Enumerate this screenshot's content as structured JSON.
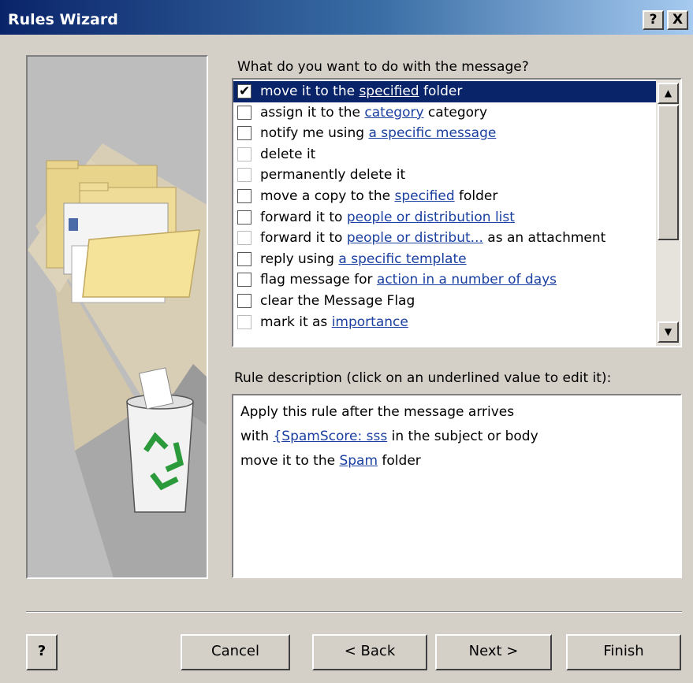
{
  "window": {
    "title": "Rules Wizard",
    "help_glyph": "?",
    "close_glyph": "X"
  },
  "actions": {
    "prompt": "What do you want to do with the message?",
    "items": [
      {
        "pre": "move it to the ",
        "link": "specified",
        "post": " folder",
        "checked": true,
        "selected": true
      },
      {
        "pre": "assign it to the ",
        "link": "category",
        "post": " category",
        "checked": false,
        "selected": false
      },
      {
        "pre": "notify me using ",
        "link": "a specific message",
        "post": "",
        "checked": false,
        "selected": false
      },
      {
        "pre": "delete it",
        "link": "",
        "post": "",
        "checked": false,
        "selected": false
      },
      {
        "pre": "permanently delete it",
        "link": "",
        "post": "",
        "checked": false,
        "selected": false
      },
      {
        "pre": "move a copy to the ",
        "link": "specified",
        "post": " folder",
        "checked": false,
        "selected": false
      },
      {
        "pre": "forward it to ",
        "link": "people or distribution list",
        "post": "",
        "checked": false,
        "selected": false
      },
      {
        "pre": "forward it to ",
        "link": "people or distribut...",
        "post": "  as an attachment",
        "checked": false,
        "selected": false
      },
      {
        "pre": "reply using ",
        "link": "a specific template",
        "post": "",
        "checked": false,
        "selected": false
      },
      {
        "pre": "flag message for ",
        "link": "action in a number of days",
        "post": "",
        "checked": false,
        "selected": false
      },
      {
        "pre": "clear the Message Flag",
        "link": "",
        "post": "",
        "checked": false,
        "selected": false
      },
      {
        "pre": "mark it as ",
        "link": "importance",
        "post": "",
        "checked": false,
        "selected": false
      }
    ],
    "scroll_up_glyph": "▲",
    "scroll_down_glyph": "▼"
  },
  "description": {
    "label": "Rule description (click on an underlined value to edit it):",
    "lines": [
      {
        "pre": "Apply this rule after the message arrives",
        "link": "",
        "post": ""
      },
      {
        "pre": "with ",
        "link": "{SpamScore: sss",
        "post": " in the subject or body"
      },
      {
        "pre": "move it to the ",
        "link": "Spam",
        "post": " folder"
      }
    ]
  },
  "buttons": {
    "help": "?",
    "cancel": "Cancel",
    "back": "< Back",
    "next": "Next >",
    "finish": "Finish"
  },
  "colors": {
    "dialog_bg": "#d4d0c8",
    "titlebar_dark": "#0a246a",
    "selection": "#0a246a",
    "link": "#1a3fa0"
  },
  "icons": {
    "illustration": "folders-and-recycle-bin-illustration",
    "checkbox": "checkbox-icon"
  }
}
